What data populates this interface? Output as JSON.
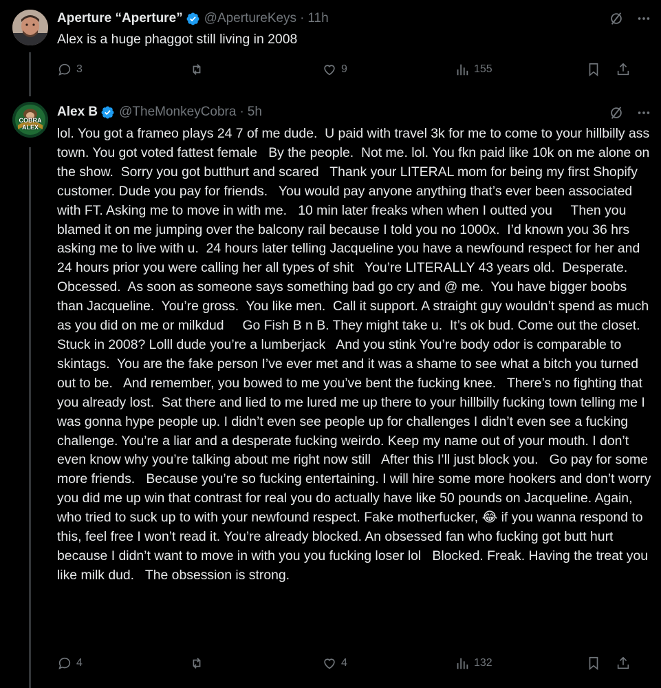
{
  "tweets": [
    {
      "author_name": "Aperture “Aperture”",
      "handle": "@ApertureKeys",
      "separator": "·",
      "time": "11h",
      "text": "Alex is a huge phaggot still living in 2008",
      "replies": "3",
      "retweets": "",
      "likes": "9",
      "views": "155",
      "avatar_icon": "avatar-photo-man"
    },
    {
      "author_name": "Alex B",
      "handle": "@TheMonkeyCobra",
      "separator": "·",
      "time": "5h",
      "avatar_text": [
        "COBRA",
        "ALEX"
      ],
      "text": "lol. You got a frameo plays 24 7 of me dude.  U paid with travel 3k for me to come to your hillbilly ass town. You got voted fattest female   By the people.  Not me. lol. You fkn paid like 10k on me alone on the show.  Sorry you got butthurt and scared   Thank your LITERAL mom for being my first Shopify customer. Dude you pay for friends.   You would pay anyone anything that’s ever been associated with FT. Asking me to move in with me.   10 min later freaks when when I outted you     Then you blamed it on me jumping over the balcony rail because I told you no 1000x.  I’d known you 36 hrs asking me to live with u.  24 hours later telling Jacqueline you have a newfound respect for her and 24 hours prior you were calling her all types of shit   You’re LITERALLY 43 years old.  Desperate.  Obcessed.  As soon as someone says something bad go cry and @ me.  You have bigger boobs than Jacqueline.  You’re gross.  You like men.  Call it support. A straight guy wouldn’t spend as much as you did on me or milkdud     Go Fish B n B. They might take u.  It’s ok bud. Come out the closet.    Stuck in 2008? Lolll dude you’re a lumberjack   And you stink You’re body odor is comparable to skintags.  You are the fake person I’ve ever met and it was a shame to see what a bitch you turned out to be.   And remember, you bowed to me you’ve bent the fucking knee.   There’s no fighting that you already lost.  Sat there and lied to me lured me up there to your hillbilly fucking town telling me I was gonna hype people up. I didn’t even see people up for challenges I didn’t even see a fucking challenge. You’re a liar and a desperate fucking weirdo. Keep my name out of your mouth. I don’t even know why you’re talking about me right now still   After this I’ll just block you.   Go pay for some more friends.   Because you’re so fucking entertaining. I will hire some more hookers and don’t worry you did me up win that contrast for real you do actually have like 50 pounds on Jacqueline. Again, who tried to suck up to with your newfound respect. Fake motherfucker, 😂 if you wanna respond to this, feel free I won’t read it. You’re already blocked. An obsessed fan who fucking got butt hurt because I didn’t want to move in with you you fucking loser lol   Blocked. Freak. Having the treat you like milk dud.   The obsession is strong.",
      "replies": "4",
      "retweets": "",
      "likes": "4",
      "views": "132"
    }
  ],
  "colors": {
    "background": "#000000",
    "text_primary": "#e7e9ea",
    "text_secondary": "#71767b",
    "verified_blue": "#1d9bf0",
    "thread_line": "#333639"
  },
  "icons": [
    "verified-badge-icon",
    "grok-slash-icon",
    "more-icon",
    "reply-icon",
    "retweet-icon",
    "like-icon",
    "views-icon",
    "bookmark-icon",
    "share-icon"
  ]
}
